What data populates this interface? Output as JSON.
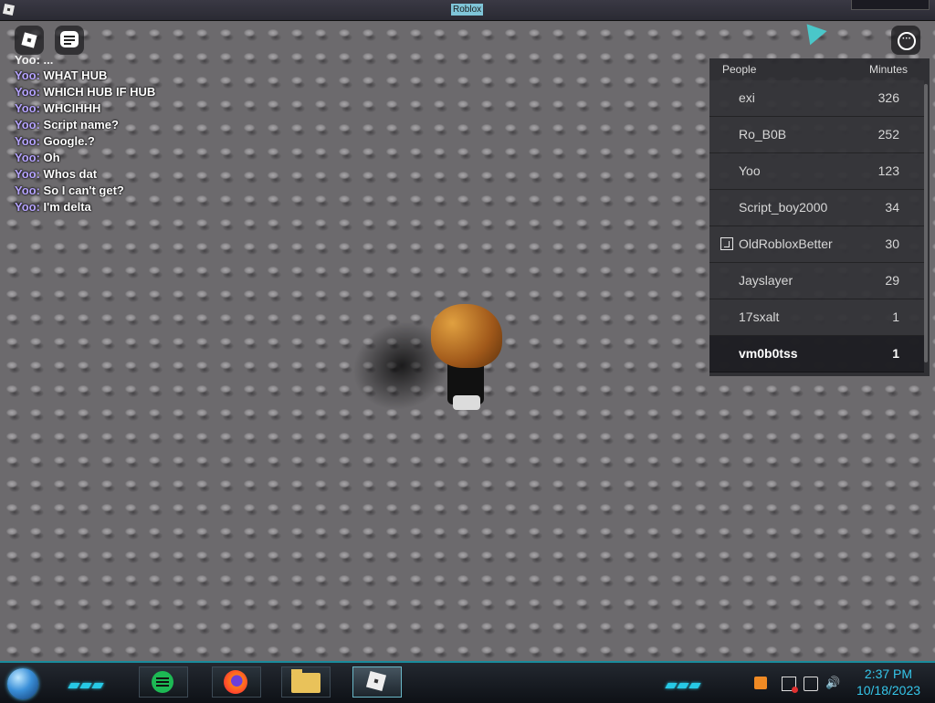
{
  "window": {
    "title": "Roblox"
  },
  "chat": {
    "clipped_line": "Yoo: ...",
    "messages": [
      {
        "user": "Yoo:",
        "text": "WHAT HUB"
      },
      {
        "user": "Yoo:",
        "text": "WHICH HUB IF HUB"
      },
      {
        "user": "Yoo:",
        "text": "WHCIHHH"
      },
      {
        "user": "Yoo:",
        "text": "Script name?"
      },
      {
        "user": "Yoo:",
        "text": "Google.?"
      },
      {
        "user": "Yoo:",
        "text": "Oh"
      },
      {
        "user": "Yoo:",
        "text": "Whos dat"
      },
      {
        "user": "Yoo:",
        "text": "So I can't get?"
      },
      {
        "user": "Yoo:",
        "text": "I'm delta"
      }
    ]
  },
  "leaderboard": {
    "col_people": "People",
    "col_minutes": "Minutes",
    "rows": [
      {
        "name": "exi",
        "minutes": "326"
      },
      {
        "name": "Ro_B0B",
        "minutes": "252"
      },
      {
        "name": "Yoo",
        "minutes": "123"
      },
      {
        "name": "Script_boy2000",
        "minutes": "34"
      },
      {
        "name": "OldRobloxBetter",
        "minutes": "30",
        "badge": "premium-icon"
      },
      {
        "name": "Jayslayer",
        "minutes": "29"
      },
      {
        "name": "17sxalt",
        "minutes": "1"
      },
      {
        "name": "vm0b0tss",
        "minutes": "1",
        "is_local": true
      }
    ]
  },
  "taskbar": {
    "time": "2:37 PM",
    "date": "10/18/2023",
    "apps": [
      "spotify-icon",
      "firefox-icon",
      "file-manager-icon",
      "roblox-icon"
    ],
    "accent": "#27c9e6"
  }
}
